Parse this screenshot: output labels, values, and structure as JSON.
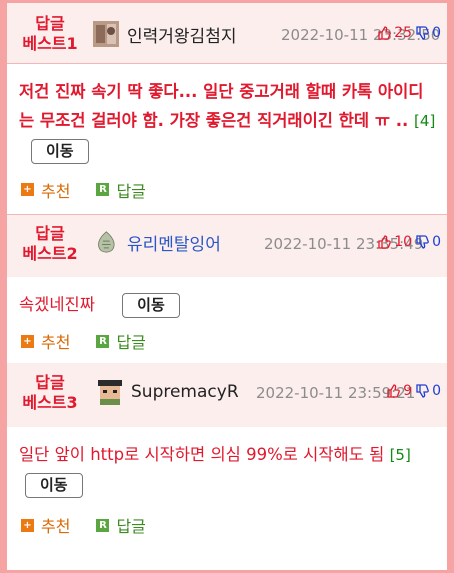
{
  "comments": [
    {
      "badge_line1": "답글",
      "badge_line2": "베스트1",
      "username": "인력거왕김첨지",
      "datetime": "2022-10-11 23:32:50",
      "upvotes": "25",
      "downvotes": "0",
      "text": "저건 진짜 속기 딱 좋다... 일단 중고거래 할때 카톡 아이디는 무조건 걸러야 함. 가장 좋은건 직거래이긴 한데 ㅠ ..",
      "reply_count": "[4]",
      "move_label": "이동",
      "recommend_label": "추천",
      "reply_label": "답글"
    },
    {
      "badge_line1": "답글",
      "badge_line2": "베스트2",
      "username": "유리멘탈잉어",
      "datetime": "2022-10-11 23:35:49",
      "upvotes": "10",
      "downvotes": "0",
      "text": "속겠네진짜",
      "move_label": "이동",
      "recommend_label": "추천",
      "reply_label": "답글"
    },
    {
      "badge_line1": "답글",
      "badge_line2": "베스트3",
      "username": "SupremacyR",
      "datetime": "2022-10-11 23:59:21",
      "upvotes": "9",
      "downvotes": "0",
      "text": "일단 앞이 http로 시작하면 의심 99%로 시작해도 됨",
      "reply_count": "[5]",
      "move_label": "이동",
      "recommend_label": "추천",
      "reply_label": "답글"
    }
  ],
  "icons": {
    "thumbs_up": "thumbs-up-icon",
    "thumbs_down": "thumbs-down-icon",
    "recommend": "plus-square-icon",
    "reply": "reply-r-icon"
  },
  "colors": {
    "page_background": "#f5a3a3",
    "header_background": "#fdeeee",
    "badge_text": "#e0192e",
    "comment_text": "#e0192e",
    "reply_count": "#138a13",
    "username_blue": "#2a56c6",
    "upvote": "#e0192e",
    "downvote": "#1c3fd1",
    "recommend": "#d96a05",
    "reply": "#3d8a20"
  }
}
